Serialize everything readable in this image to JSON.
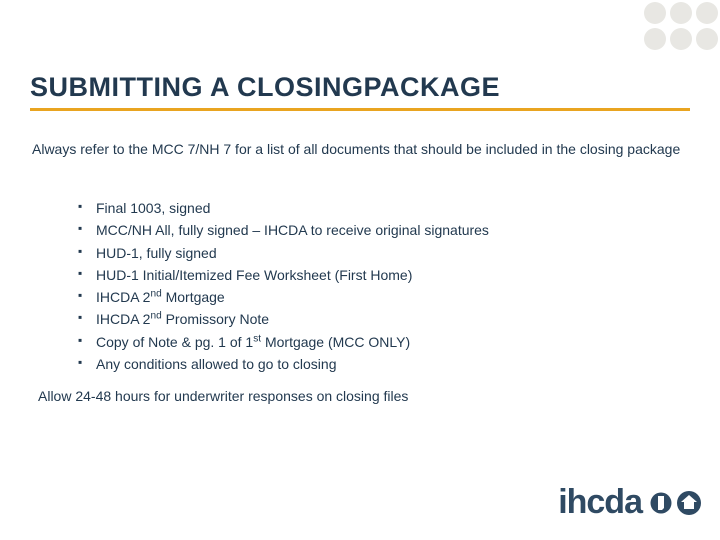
{
  "heading": "SUBMITTING A CLOSINGPACKAGE",
  "intro": "Always refer to the MCC 7/NH 7 for a list of all documents that should be included in the closing package",
  "items": [
    {
      "pre": "Final 1003, signed"
    },
    {
      "pre": "MCC/NH All, fully signed – IHCDA to receive original signatures"
    },
    {
      "pre": "HUD-1, fully signed"
    },
    {
      "pre": "HUD-1 Initial/Itemized Fee Worksheet (First Home)"
    },
    {
      "pre": "IHCDA 2",
      "sup": "nd",
      "post": " Mortgage"
    },
    {
      "pre": "IHCDA 2",
      "sup": "nd",
      "post": " Promissory Note"
    },
    {
      "pre": "Copy of Note & pg. 1 of 1",
      "sup": "st",
      "post": " Mortgage (MCC ONLY)"
    },
    {
      "pre": "Any conditions allowed to go to closing"
    }
  ],
  "footer": "Allow 24-48 hours for underwriter responses on closing files",
  "logo": {
    "text": "ihcda"
  }
}
